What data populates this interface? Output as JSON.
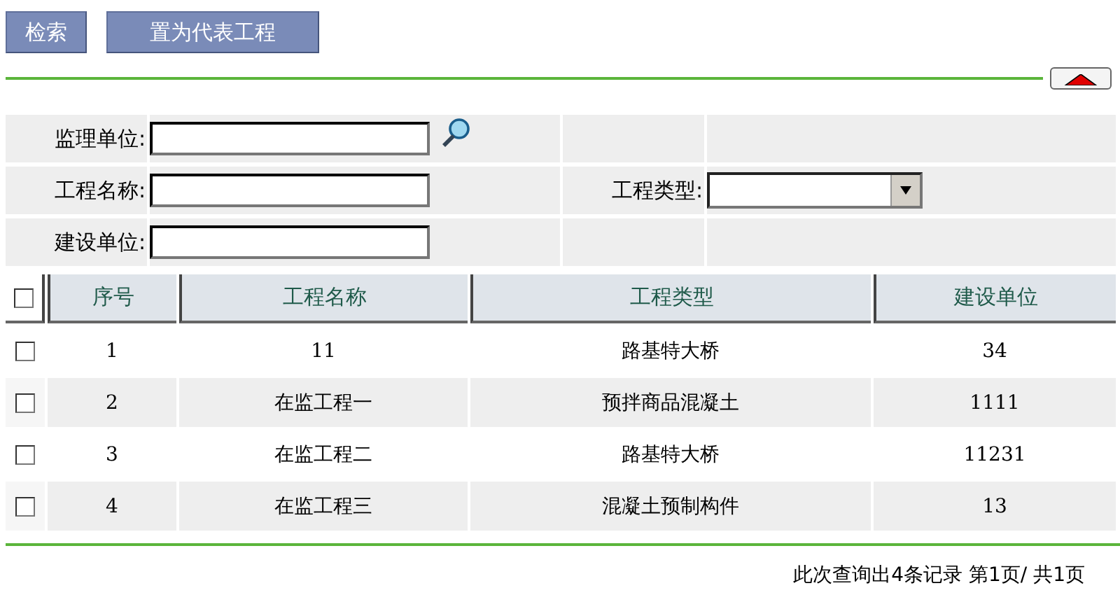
{
  "toolbar": {
    "buttons": [
      "检索",
      "置为代表工程"
    ]
  },
  "collapse": {
    "expanded": true
  },
  "search_form": {
    "rows": [
      {
        "fields": [
          {
            "label": "监理单位:",
            "kind": "lookup"
          }
        ]
      },
      {
        "fields": [
          {
            "label": "工程名称:",
            "kind": "text"
          },
          {
            "label": "工程类型:",
            "kind": "select"
          }
        ]
      },
      {
        "fields": [
          {
            "label": "建设单位:",
            "kind": "text"
          }
        ]
      }
    ]
  },
  "table": {
    "select_all": {
      "checked": false
    },
    "columns": [
      "序号",
      "工程名称",
      "工程类型",
      "建设单位"
    ],
    "rows": [
      {
        "checked": false,
        "cells": [
          "1",
          "11",
          "路基特大桥",
          "34"
        ]
      },
      {
        "checked": false,
        "cells": [
          "2",
          "在监工程一",
          "预拌商品混凝土",
          "1111"
        ]
      },
      {
        "checked": false,
        "cells": [
          "3",
          "在监工程二",
          "路基特大桥",
          "11231"
        ]
      },
      {
        "checked": false,
        "cells": [
          "4",
          "在监工程三",
          "混凝土预制构件",
          "13"
        ]
      }
    ]
  },
  "footer": {
    "summary": "此次查询出4条记录 第1页/ 共1页"
  }
}
